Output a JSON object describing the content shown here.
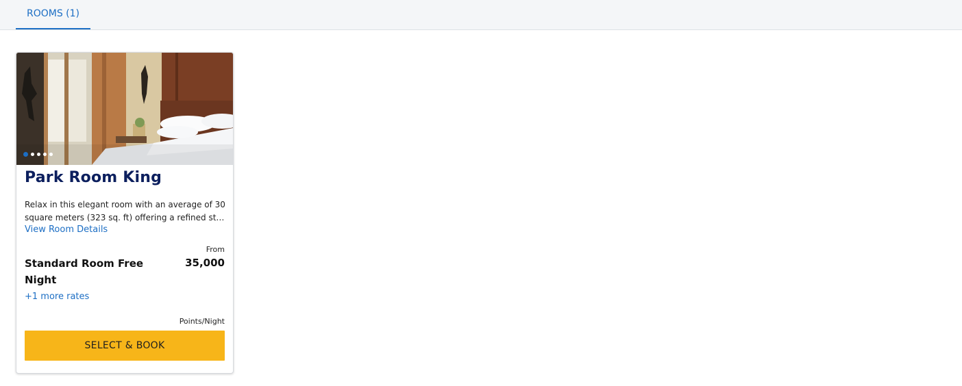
{
  "tabs": [
    {
      "label": "ROOMS (1)",
      "active": true
    }
  ],
  "room": {
    "title": "Park Room King",
    "description": "Relax in this elegant room with an average of 30 square meters (323 sq. ft) offering a refined stay with modern amenities and city views.",
    "details_link": "View Room Details",
    "from_label": "From",
    "rate_name": "Standard Room Free Night",
    "price": "35,000",
    "more_rates": "+1 more rates",
    "unit_label": "Points/Night",
    "book_button": "SELECT & BOOK",
    "carousel": {
      "total": 5,
      "active_index": 0
    }
  },
  "colors": {
    "accent": "#1c6ec4",
    "title": "#0c1f5e",
    "button": "#f7b519",
    "tabbar": "#f4f6f8"
  }
}
